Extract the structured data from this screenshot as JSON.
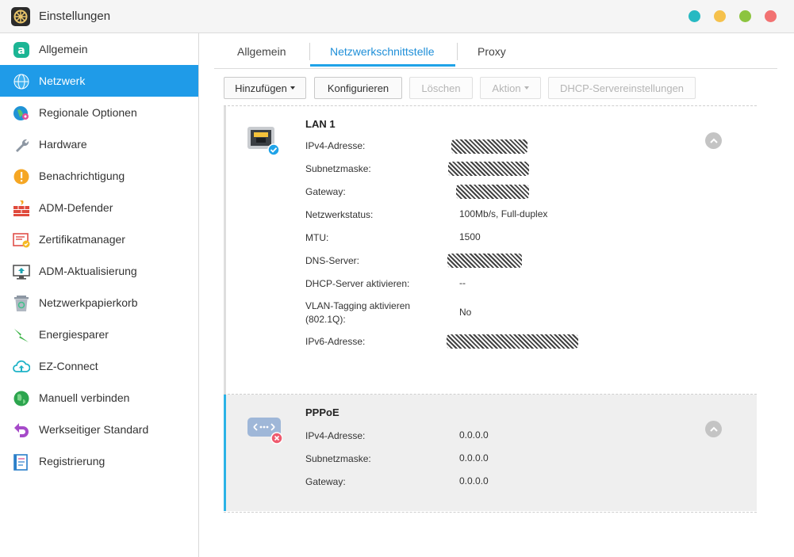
{
  "window": {
    "title": "Einstellungen"
  },
  "sidebar": {
    "items": [
      {
        "label": "Allgemein",
        "icon": "asustor-a-icon"
      },
      {
        "label": "Netzwerk",
        "icon": "globe-icon",
        "active": true
      },
      {
        "label": "Regionale Optionen",
        "icon": "globe-pin-icon"
      },
      {
        "label": "Hardware",
        "icon": "wrench-icon"
      },
      {
        "label": "Benachrichtigung",
        "icon": "alert-icon"
      },
      {
        "label": "ADM-Defender",
        "icon": "firewall-icon"
      },
      {
        "label": "Zertifikatmanager",
        "icon": "certificate-icon"
      },
      {
        "label": "ADM-Aktualisierung",
        "icon": "monitor-upload-icon"
      },
      {
        "label": "Netzwerkpapierkorb",
        "icon": "recycle-bin-icon"
      },
      {
        "label": "Energiesparer",
        "icon": "lightning-icon"
      },
      {
        "label": "EZ-Connect",
        "icon": "cloud-upload-icon"
      },
      {
        "label": "Manuell verbinden",
        "icon": "globe-green-icon"
      },
      {
        "label": "Werkseitiger Standard",
        "icon": "undo-arrow-icon"
      },
      {
        "label": "Registrierung",
        "icon": "clipboard-icon"
      }
    ]
  },
  "tabs": [
    {
      "label": "Allgemein"
    },
    {
      "label": "Netzwerkschnittstelle",
      "active": true
    },
    {
      "label": "Proxy"
    }
  ],
  "toolbar": {
    "add": "Hinzufügen",
    "configure": "Konfigurieren",
    "delete": "Löschen",
    "action": "Aktion",
    "dhcp": "DHCP-Servereinstellungen"
  },
  "lan": {
    "title": "LAN 1",
    "rows": [
      {
        "label": "IPv4-Adresse:",
        "value": ""
      },
      {
        "label": "Subnetzmaske:",
        "value": ""
      },
      {
        "label": "Gateway:",
        "value": ""
      },
      {
        "label": "Netzwerkstatus:",
        "value": "100Mb/s, Full-duplex"
      },
      {
        "label": "MTU:",
        "value": "1500"
      },
      {
        "label": "DNS-Server:",
        "value": ""
      },
      {
        "label": "DHCP-Server aktivieren:",
        "value": "--"
      },
      {
        "label": "VLAN-Tagging aktivieren",
        "label2": "(802.1Q):",
        "value": "No"
      },
      {
        "label": "IPv6-Adresse:",
        "value": ""
      }
    ]
  },
  "pppoe": {
    "title": "PPPoE",
    "rows": [
      {
        "label": "IPv4-Adresse:",
        "value": "0.0.0.0"
      },
      {
        "label": "Subnetzmaske:",
        "value": "0.0.0.0"
      },
      {
        "label": "Gateway:",
        "value": "0.0.0.0"
      }
    ]
  },
  "colors": {
    "accent": "#1f9be8",
    "tab_active": "#1f8fd8",
    "pppoe_bar": "#2bb3e6"
  }
}
